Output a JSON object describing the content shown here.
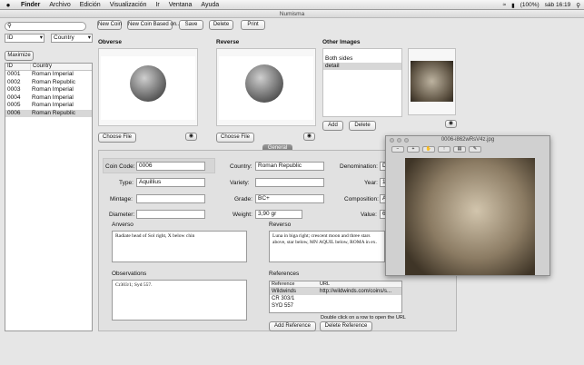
{
  "menubar": {
    "apple": "",
    "items": [
      "Finder",
      "Archivo",
      "Edición",
      "Visualización",
      "Ir",
      "Ventana",
      "Ayuda"
    ],
    "status": {
      "battery": "(100%)",
      "clock": "sáb 16:19"
    }
  },
  "window": {
    "title": "Numisma"
  },
  "toolbar": {
    "new_coin": "New Coin",
    "new_coin_based": "New Coin Based on...",
    "save": "Save",
    "delete": "Delete",
    "print": "Print"
  },
  "search": {
    "placeholder": ""
  },
  "filter": {
    "field": "ID",
    "field2": "Country",
    "maximize": "Maximize"
  },
  "coin_list": {
    "headers": [
      "ID",
      "Country"
    ],
    "rows": [
      {
        "id": "0001",
        "country": "Roman Imperial"
      },
      {
        "id": "0002",
        "country": "Roman Republic"
      },
      {
        "id": "0003",
        "country": "Roman Imperial"
      },
      {
        "id": "0004",
        "country": "Roman Imperial"
      },
      {
        "id": "0005",
        "country": "Roman Imperial"
      },
      {
        "id": "0006",
        "country": "Roman Republic"
      }
    ],
    "selected_index": 5
  },
  "images": {
    "obverse_label": "Obverse",
    "reverse_label": "Reverse",
    "other_label": "Other Images",
    "choose_file": "Choose File",
    "other_list": [
      "Both sides",
      "detail"
    ],
    "add": "Add",
    "delete": "Delete"
  },
  "tab": {
    "label": "General"
  },
  "form": {
    "coin_code_label": "Coin Code:",
    "coin_code": "0006",
    "country_label": "Country:",
    "country": "Roman Republic",
    "denomination_label": "Denomination:",
    "denomination": "D",
    "type_label": "Type:",
    "type": "Aquillius",
    "variety_label": "Variety:",
    "variety": "",
    "year_label": "Year:",
    "year": "1",
    "mintage_label": "Mintage:",
    "mintage": "",
    "grade_label": "Grade:",
    "grade": "BC+",
    "composition_label": "Composition:",
    "composition": "A",
    "diameter_label": "Diameter:",
    "diameter": "",
    "weight_label": "Weight:",
    "weight": "3,90 gr",
    "value_label": "Value:",
    "value": "6",
    "anverso_label": "Anverso",
    "anverso": "Radiate head of Sol right, X below chin",
    "reverso_label": "Reverso",
    "reverso": "Luna in biga right; crescent moon and three stars above, star below, MN AQUIL below, ROMA in ex.",
    "observations_label": "Observations",
    "observations": "Cr303/1; Syd 557.",
    "references_label": "References",
    "ref_headers": [
      "Reference",
      "URL"
    ],
    "refs": [
      {
        "ref": "Wildwinds",
        "url": "http://wildwinds.com/coins/s..."
      },
      {
        "ref": "CR 303/1",
        "url": ""
      },
      {
        "ref": "SYD 557",
        "url": ""
      }
    ],
    "ref_hint": "Double click on a row to open the URL",
    "add_reference": "Add Reference",
    "delete_reference": "Delete Reference"
  },
  "preview": {
    "title": "0006-i862wRsV4z.jpg"
  }
}
